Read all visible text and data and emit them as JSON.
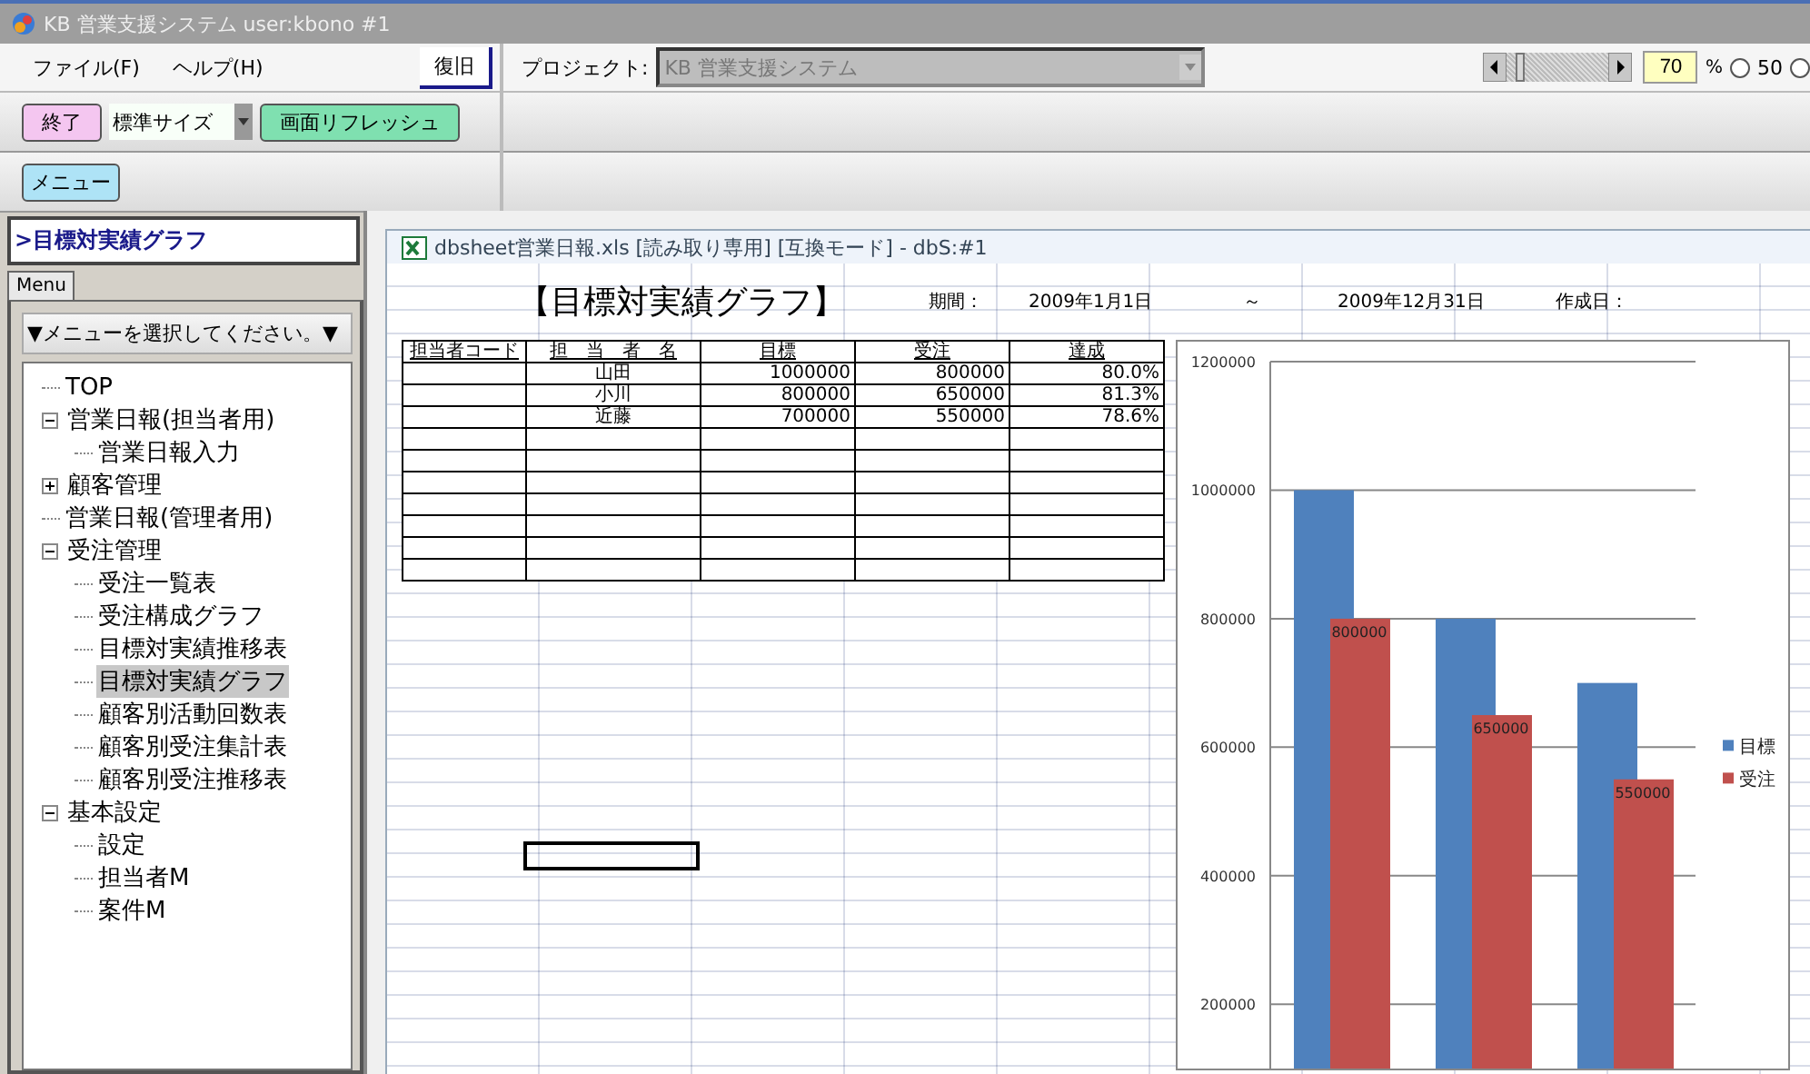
{
  "window": {
    "title": "KB 営業支援システム user:kbono #1"
  },
  "menubar": {
    "items": [
      "ファイル(F)",
      "ヘルプ(H)"
    ],
    "restore_button": "復旧"
  },
  "project": {
    "label": "プロジェクト:",
    "value": "KB 営業支援システム"
  },
  "zoom": {
    "level": 0.1,
    "value": "70",
    "unit": "%",
    "radios": [
      {
        "label": "50",
        "selected": false
      },
      {
        "selected": false
      }
    ]
  },
  "toolbar": {
    "exit_button": "終了",
    "size_select": "標準サイズ",
    "refresh_button": "画面リフレッシュ",
    "menu_button": "メニュー"
  },
  "sidebar": {
    "current": ">目標対実績グラフ",
    "tab": "Menu",
    "menu_select": "▼メニューを選択してください。▼",
    "tree": [
      {
        "label": "TOP",
        "selected": false
      },
      {
        "label": "営業日報(担当者用)",
        "expanded": true,
        "selected": false,
        "children": [
          {
            "label": "営業日報入力",
            "selected": false
          }
        ]
      },
      {
        "label": "顧客管理",
        "expanded": false,
        "selected": false
      },
      {
        "label": "営業日報(管理者用)",
        "selected": false
      },
      {
        "label": "受注管理",
        "expanded": true,
        "selected": false,
        "children": [
          {
            "label": "受注一覧表",
            "selected": false
          },
          {
            "label": "受注構成グラフ",
            "selected": false
          },
          {
            "label": "目標対実績推移表",
            "selected": false
          },
          {
            "label": "目標対実績グラフ",
            "selected": true
          },
          {
            "label": "顧客別活動回数表",
            "selected": false
          },
          {
            "label": "顧客別受注集計表",
            "selected": false
          },
          {
            "label": "顧客別受注推移表",
            "selected": false
          }
        ]
      },
      {
        "label": "基本設定",
        "expanded": true,
        "selected": false,
        "children": [
          {
            "label": "設定",
            "selected": false
          },
          {
            "label": "担当者M",
            "selected": false
          },
          {
            "label": "案件M",
            "selected": false
          }
        ]
      }
    ]
  },
  "sheet": {
    "title": "dbsheet営業日報.xls  [読み取り専用]  [互換モード] - dbS:#1",
    "heading": "【目標対実績グラフ】",
    "period_label": "期間：",
    "period_from": "2009年1月1日",
    "period_sep": "～",
    "period_to": "2009年12月31日",
    "created_label": "作成日：",
    "table": {
      "columns": [
        "担当者コード",
        "担　当　者　名",
        "目標",
        "受注",
        "達成"
      ],
      "rows": [
        [
          "",
          "山田",
          "1000000",
          "800000",
          "80.0%"
        ],
        [
          "",
          "小川",
          "800000",
          "650000",
          "81.3%"
        ],
        [
          "",
          "近藤",
          "700000",
          "550000",
          "78.6%"
        ]
      ]
    },
    "chart_data": {
      "type": "bar",
      "grid": true,
      "legend": true,
      "ylim": [
        100000,
        1200000
      ],
      "yticks": [
        {
          "value": 200000,
          "label": "200000"
        },
        {
          "value": 400000,
          "label": "400000"
        },
        {
          "value": 600000,
          "label": "600000"
        },
        {
          "value": 800000,
          "label": "800000"
        },
        {
          "value": 1000000,
          "label": "1000000"
        },
        {
          "value": 1200000,
          "label": "1200000"
        }
      ],
      "series": [
        {
          "name": "目標",
          "color": "#4f81bd",
          "values": [
            1000000,
            800000,
            700000
          ]
        },
        {
          "name": "受注",
          "color": "#c0504d",
          "values": [
            800000,
            650000,
            550000
          ],
          "value_labels": [
            "800000",
            "650000",
            "550000"
          ]
        }
      ]
    }
  }
}
